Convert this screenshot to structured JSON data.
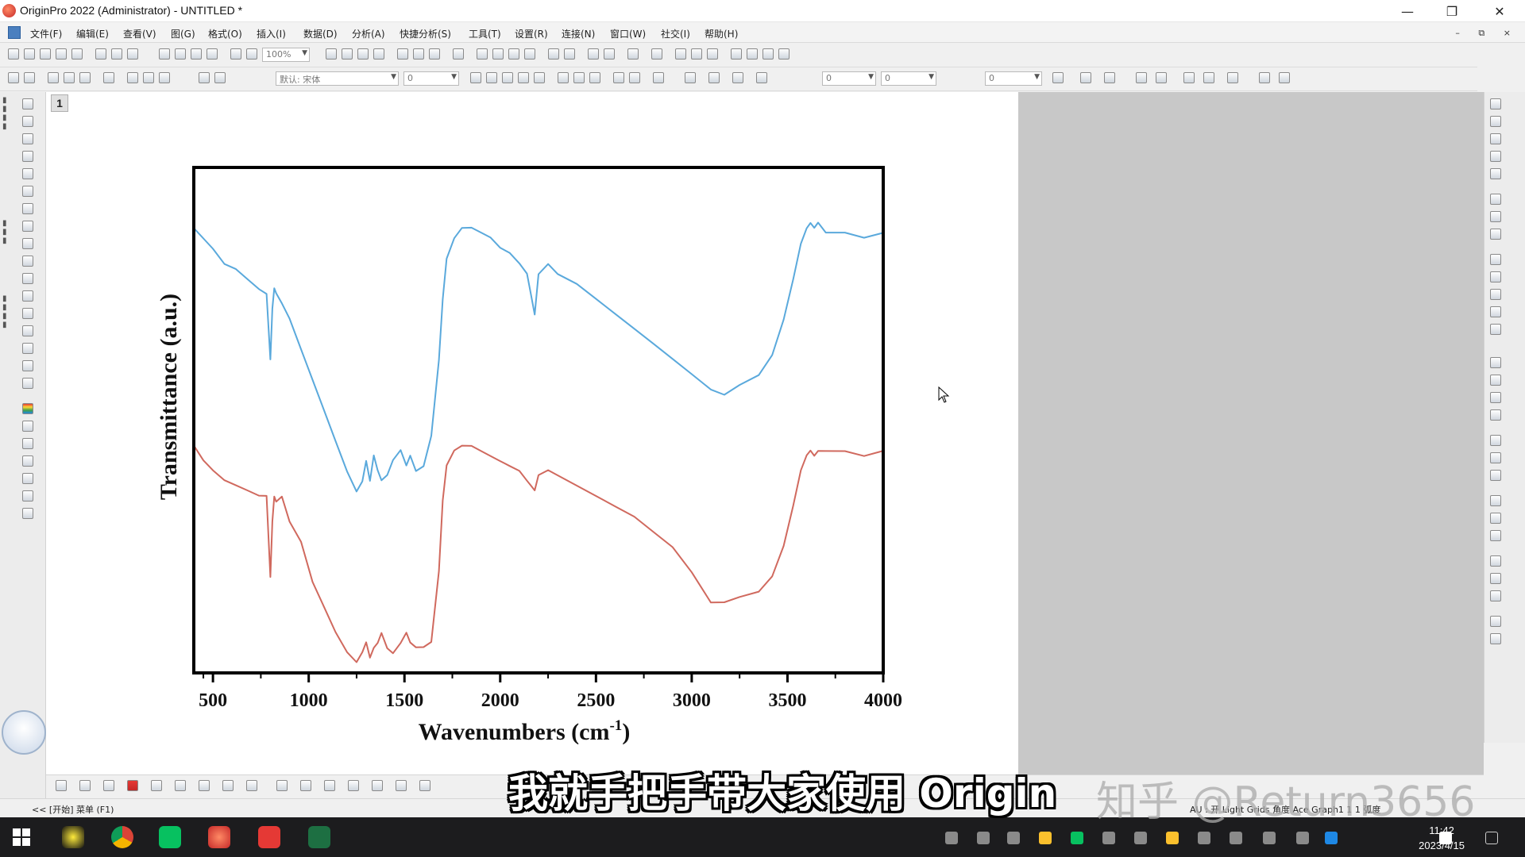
{
  "window": {
    "title": "OriginPro 2022 (Administrator) - UNTITLED *",
    "controls": [
      "—",
      "❐",
      "✕"
    ]
  },
  "menu": {
    "items": [
      "文件(F)",
      "编辑(E)",
      "查看(V)",
      "图(G)",
      "格式(O)",
      "插入(I)",
      "数据(D)",
      "分析(A)",
      "快捷分析(S)",
      "工具(T)",
      "设置(R)",
      "连接(N)",
      "窗口(W)",
      "社交(I)",
      "帮助(H)"
    ],
    "mdi_controls": "– ⧉ ×"
  },
  "toolbar": {
    "zoom_value": "100%",
    "font_value": "默认: 宋体",
    "font_size_value": "0",
    "line_value": "0",
    "line_value2": "0"
  },
  "graph": {
    "layer_label": "1"
  },
  "chart_data": {
    "type": "line",
    "xlabel": "Wavenumbers (cm-1)",
    "xlabel_base": "Wavenumbers (cm",
    "xlabel_sup": "-1",
    "xlabel_close": ")",
    "ylabel": "Transmittance (a.u.)",
    "xlim": [
      400,
      4000
    ],
    "ylim": [
      0,
      1
    ],
    "x_ticks": [
      "500",
      "1000",
      "1500",
      "2000",
      "2500",
      "3000",
      "3500",
      "4000"
    ],
    "series": [
      {
        "color": "#5aa9dc",
        "x": [
          400,
          450,
          500,
          560,
          620,
          680,
          740,
          780,
          800,
          810,
          820,
          830,
          860,
          900,
          960,
          1020,
          1080,
          1140,
          1200,
          1250,
          1280,
          1300,
          1320,
          1340,
          1360,
          1380,
          1410,
          1440,
          1480,
          1510,
          1530,
          1560,
          1600,
          1640,
          1680,
          1700,
          1720,
          1760,
          1800,
          1850,
          1900,
          1950,
          2000,
          2050,
          2100,
          2140,
          2160,
          2180,
          2200,
          2250,
          2300,
          2400,
          2500,
          2600,
          2700,
          2800,
          2900,
          3000,
          3100,
          3170,
          3250,
          3350,
          3420,
          3480,
          3530,
          3570,
          3600,
          3620,
          3640,
          3660,
          3700,
          3800,
          3900,
          4000
        ],
        "y": [
          0.88,
          0.86,
          0.84,
          0.81,
          0.8,
          0.78,
          0.76,
          0.75,
          0.62,
          0.72,
          0.76,
          0.75,
          0.73,
          0.7,
          0.64,
          0.58,
          0.52,
          0.46,
          0.4,
          0.36,
          0.38,
          0.42,
          0.38,
          0.43,
          0.4,
          0.38,
          0.39,
          0.42,
          0.44,
          0.41,
          0.43,
          0.4,
          0.41,
          0.47,
          0.62,
          0.74,
          0.82,
          0.86,
          0.88,
          0.88,
          0.87,
          0.86,
          0.84,
          0.83,
          0.81,
          0.79,
          0.75,
          0.71,
          0.79,
          0.81,
          0.79,
          0.77,
          0.74,
          0.71,
          0.68,
          0.65,
          0.62,
          0.59,
          0.56,
          0.55,
          0.57,
          0.59,
          0.63,
          0.7,
          0.78,
          0.85,
          0.88,
          0.89,
          0.88,
          0.89,
          0.87,
          0.87,
          0.86,
          0.87
        ]
      },
      {
        "color": "#d0695e",
        "x": [
          400,
          450,
          500,
          560,
          620,
          680,
          740,
          780,
          800,
          810,
          820,
          830,
          860,
          900,
          960,
          1020,
          1080,
          1140,
          1200,
          1250,
          1280,
          1300,
          1320,
          1340,
          1360,
          1380,
          1410,
          1440,
          1480,
          1510,
          1530,
          1560,
          1600,
          1640,
          1680,
          1700,
          1720,
          1760,
          1800,
          1850,
          1900,
          1950,
          2000,
          2050,
          2100,
          2140,
          2160,
          2180,
          2200,
          2250,
          2300,
          2400,
          2500,
          2600,
          2700,
          2800,
          2900,
          3000,
          3100,
          3170,
          3250,
          3350,
          3420,
          3480,
          3530,
          3570,
          3600,
          3620,
          3640,
          3660,
          3700,
          3800,
          3900,
          4000
        ],
        "y": [
          0.45,
          0.42,
          0.4,
          0.38,
          0.37,
          0.36,
          0.35,
          0.35,
          0.19,
          0.3,
          0.35,
          0.34,
          0.35,
          0.3,
          0.26,
          0.18,
          0.13,
          0.08,
          0.04,
          0.02,
          0.04,
          0.06,
          0.03,
          0.05,
          0.06,
          0.08,
          0.05,
          0.04,
          0.06,
          0.08,
          0.06,
          0.05,
          0.05,
          0.06,
          0.2,
          0.34,
          0.41,
          0.44,
          0.45,
          0.45,
          0.44,
          0.43,
          0.42,
          0.41,
          0.4,
          0.38,
          0.37,
          0.36,
          0.39,
          0.4,
          0.39,
          0.37,
          0.35,
          0.33,
          0.31,
          0.28,
          0.25,
          0.2,
          0.14,
          0.14,
          0.15,
          0.16,
          0.19,
          0.25,
          0.33,
          0.4,
          0.43,
          0.44,
          0.43,
          0.44,
          0.44,
          0.44,
          0.43,
          0.44
        ]
      }
    ]
  },
  "status": {
    "left_text": "<< [开始] 菜单 (F1)",
    "right_text": "AU : 开 Light Grids 角度 Ace Graph1 1 1 弧度"
  },
  "overlay": {
    "subtitle": "我就手把手带大家使用 Origin",
    "watermark": "知乎 @Return3656"
  },
  "taskbar": {
    "time": "11:42",
    "date": "2023/4/15"
  }
}
